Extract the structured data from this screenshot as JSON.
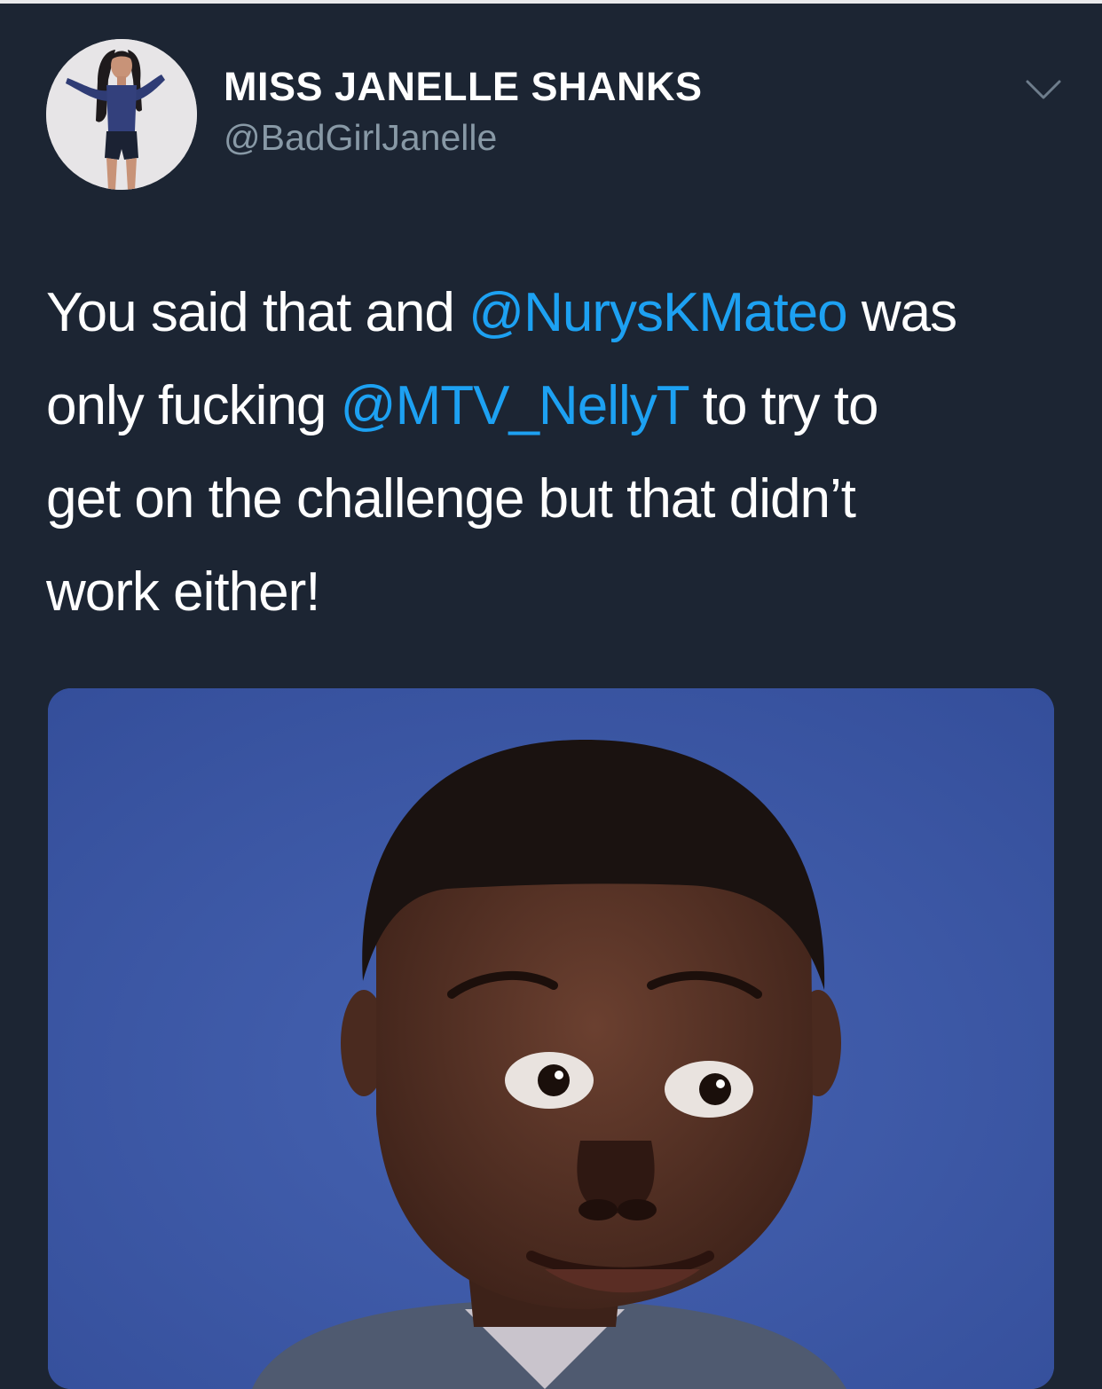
{
  "tweet": {
    "author": {
      "display_name": "MISS JANELLE SHANKS",
      "handle": "@BadGirlJanelle"
    },
    "text": {
      "line1": {
        "before": "You said that and ",
        "mention": "@NurysKMateo",
        "after": " was"
      },
      "line2": {
        "before": "only fucking ",
        "mention": "@MTV_NellyT",
        "after": " to try to"
      },
      "line3": "get on the challenge but that didn’t",
      "line4": "work either!"
    }
  },
  "icons": {
    "caret": "chevron-down-icon"
  },
  "colors": {
    "background": "#1c2533",
    "mention": "#1da1f2",
    "handle": "#8899a6",
    "media_background": "#3d59a8"
  }
}
